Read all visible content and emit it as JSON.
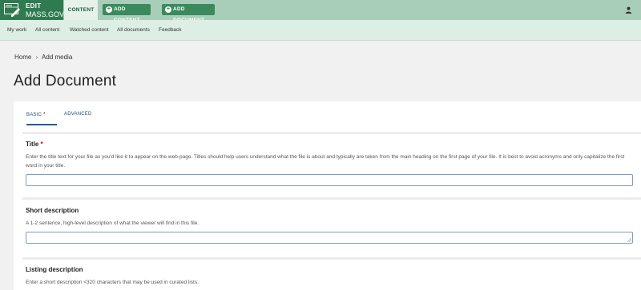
{
  "toolbar": {
    "brand_top": "EDIT",
    "brand_site": "MASS.GOV",
    "content_tab": "CONTENT",
    "add_content": "ADD CONTENT",
    "add_document": "ADD DOCUMENT"
  },
  "subnav": {
    "items": [
      "My work",
      "All content",
      "Watched content",
      "All documents",
      "Feedback"
    ]
  },
  "breadcrumb": {
    "home": "Home",
    "current": "Add media"
  },
  "page": {
    "title": "Add Document"
  },
  "tabs": {
    "basic": "BASIC",
    "basic_marker": "*",
    "advanced": "ADVANCED"
  },
  "fields": {
    "title": {
      "label": "Title",
      "required_marker": "*",
      "description": "Enter the title text for your file as you'd like it to appear on the web-page. Titles should help users understand what the file is about and typically are taken from the main heading on the first page of your file. It is best to avoid acronyms and only capitalize the first word in your title.",
      "value": ""
    },
    "short_description": {
      "label": "Short description",
      "description": "A 1-2 sentence, high-level description of what the viewer will find in this file.",
      "value": ""
    },
    "listing_description": {
      "label": "Listing description",
      "description": "Enter a short description <320 characters that may be used in curated lists."
    }
  },
  "colors": {
    "brand": "#2f7a50",
    "topbar": "#a8cdb8",
    "subnav": "#ddeee4",
    "tab_accent": "#1a5f9a",
    "required": "#cc0000"
  }
}
